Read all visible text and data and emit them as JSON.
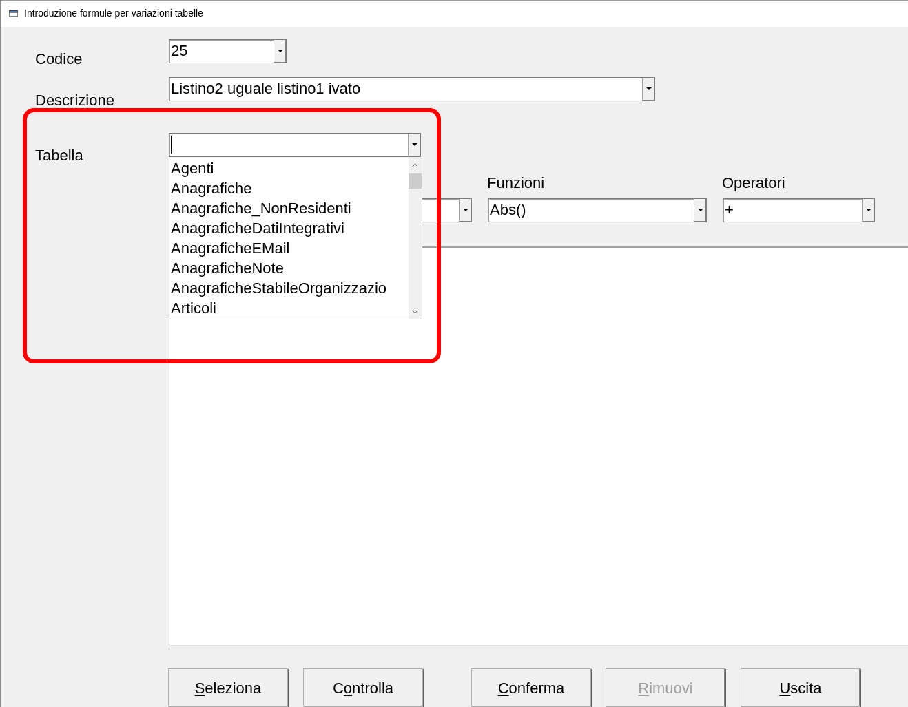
{
  "window": {
    "title": "Introduzione formule per variazioni tabelle"
  },
  "fields": [
    {
      "label": "Codice",
      "value": "25"
    },
    {
      "label": "Descrizione",
      "value": "Listino2 uguale listino1 ivato"
    },
    {
      "label": "Tabella",
      "expanded": true
    }
  ],
  "table_list": [
    "Agenti",
    "Anagrafiche",
    "Anagrafiche_NonResidenti",
    "AnagraficheDatiIntegrativi",
    "AnagraficheEMail",
    "AnagraficheNote",
    "AnagraficheStabileOrganizzazio",
    "Articoli"
  ],
  "funzioni": {
    "label": "Funzioni",
    "value": "Abs()"
  },
  "operatori": {
    "label": "Operatori",
    "value": "+"
  },
  "buttons": [
    {
      "key": "S",
      "post": "eleziona",
      "disabled": false
    },
    {
      "pre": "C",
      "key": "o",
      "post": "ntrolla",
      "disabled": false
    },
    {
      "key": "C",
      "post": "onferma",
      "disabled": false
    },
    {
      "key": "R",
      "post": "imuovi",
      "disabled": true
    },
    {
      "key": "U",
      "post": "scita",
      "disabled": false
    }
  ]
}
